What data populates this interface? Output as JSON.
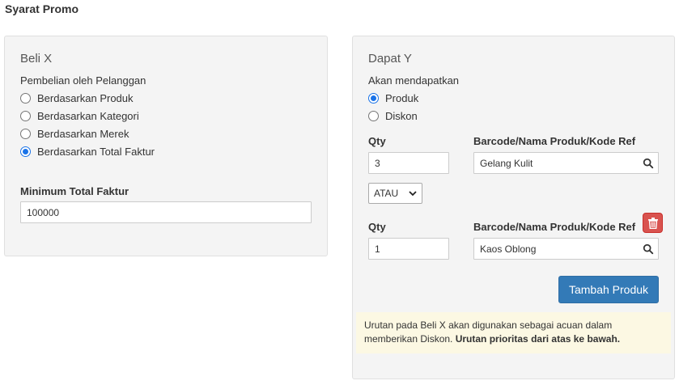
{
  "page_title": "Syarat Promo",
  "beli_x": {
    "heading": "Beli X",
    "purchase_label": "Pembelian oleh Pelanggan",
    "options": [
      {
        "label": "Berdasarkan Produk",
        "checked": false
      },
      {
        "label": "Berdasarkan Kategori",
        "checked": false
      },
      {
        "label": "Berdasarkan Merek",
        "checked": false
      },
      {
        "label": "Berdasarkan Total Faktur",
        "checked": true
      }
    ],
    "min_total_label": "Minimum Total Faktur",
    "min_total_value": "100000"
  },
  "dapat_y": {
    "heading": "Dapat Y",
    "receive_label": "Akan mendapatkan",
    "options": [
      {
        "label": "Produk",
        "checked": true
      },
      {
        "label": "Diskon",
        "checked": false
      }
    ],
    "rows": [
      {
        "qty_label": "Qty",
        "qty_value": "3",
        "product_label": "Barcode/Nama Produk/Kode Ref",
        "product_value": "Gelang Kulit"
      },
      {
        "qty_label": "Qty",
        "qty_value": "1",
        "product_label": "Barcode/Nama Produk/Kode Ref",
        "product_value": "Kaos Oblong"
      }
    ],
    "operator_select": "ATAU",
    "add_product_button": "Tambah Produk",
    "note_text": "Urutan pada Beli X akan digunakan sebagai acuan dalam memberikan Diskon. ",
    "note_bold": "Urutan prioritas dari atas ke bawah."
  },
  "colors": {
    "primary": "#337ab7",
    "danger": "#d9534f",
    "note_bg": "#fcf8e3",
    "radio_checked": "#1a73e8"
  },
  "icons": {
    "search": "search-icon",
    "delete": "trash-icon",
    "dropdown": "chevron-down-icon"
  }
}
